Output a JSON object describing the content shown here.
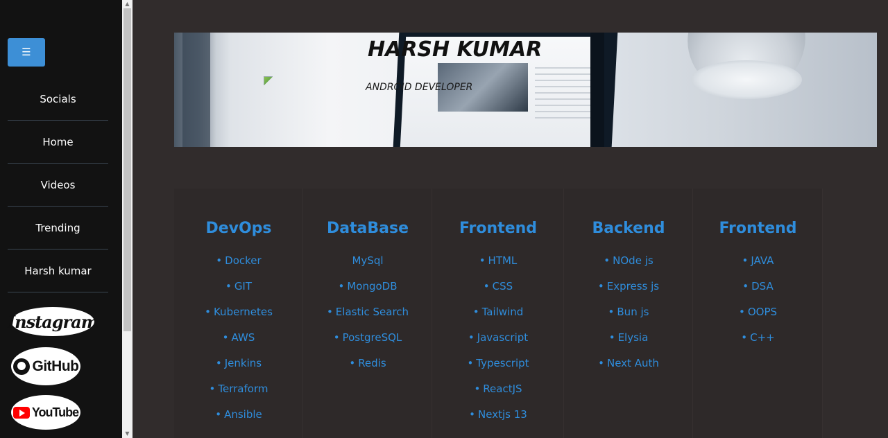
{
  "sidebar": {
    "menu_icon": "☰",
    "items": [
      {
        "label": "Socials"
      },
      {
        "label": "Home"
      },
      {
        "label": "Videos"
      },
      {
        "label": "Trending"
      },
      {
        "label": "Harsh kumar"
      }
    ],
    "socials": {
      "instagram": "Instagram",
      "github": "GitHub",
      "youtube": "YouTube"
    }
  },
  "scrollbar": {
    "up_arrow": "▲",
    "down_arrow": "▼"
  },
  "hero": {
    "title": "HARSH KUMAR",
    "subtitle": "ANDROID DEVELOPER"
  },
  "skills": [
    {
      "title": "DevOps",
      "items": [
        "Docker",
        "GIT",
        "Kubernetes",
        "AWS",
        "Jenkins",
        "Terraform",
        "Ansible"
      ]
    },
    {
      "title": "DataBase",
      "items": [
        "MySql",
        "MongoDB",
        "Elastic Search",
        "PostgreSQL",
        "Redis"
      ]
    },
    {
      "title": "Frontend",
      "items": [
        "HTML",
        "CSS",
        "Tailwind",
        "Javascript",
        "Typescript",
        "ReactJS",
        "Nextjs 13"
      ]
    },
    {
      "title": "Backend",
      "items": [
        "NOde js",
        "Express js",
        "Bun js",
        "Elysia",
        "Next Auth"
      ]
    },
    {
      "title": "Frontend",
      "items": [
        "JAVA",
        "DSA",
        "OOPS",
        "C++"
      ]
    }
  ],
  "colors": {
    "page_bg": "#312c2c",
    "sidebar_bg": "#121212",
    "accent": "#2f8ddc",
    "menu_button": "#3d8fd6"
  },
  "icons": {
    "menu": "hamburger-icon",
    "instagram": "instagram-logo",
    "github": "github-logo",
    "youtube": "youtube-logo"
  }
}
